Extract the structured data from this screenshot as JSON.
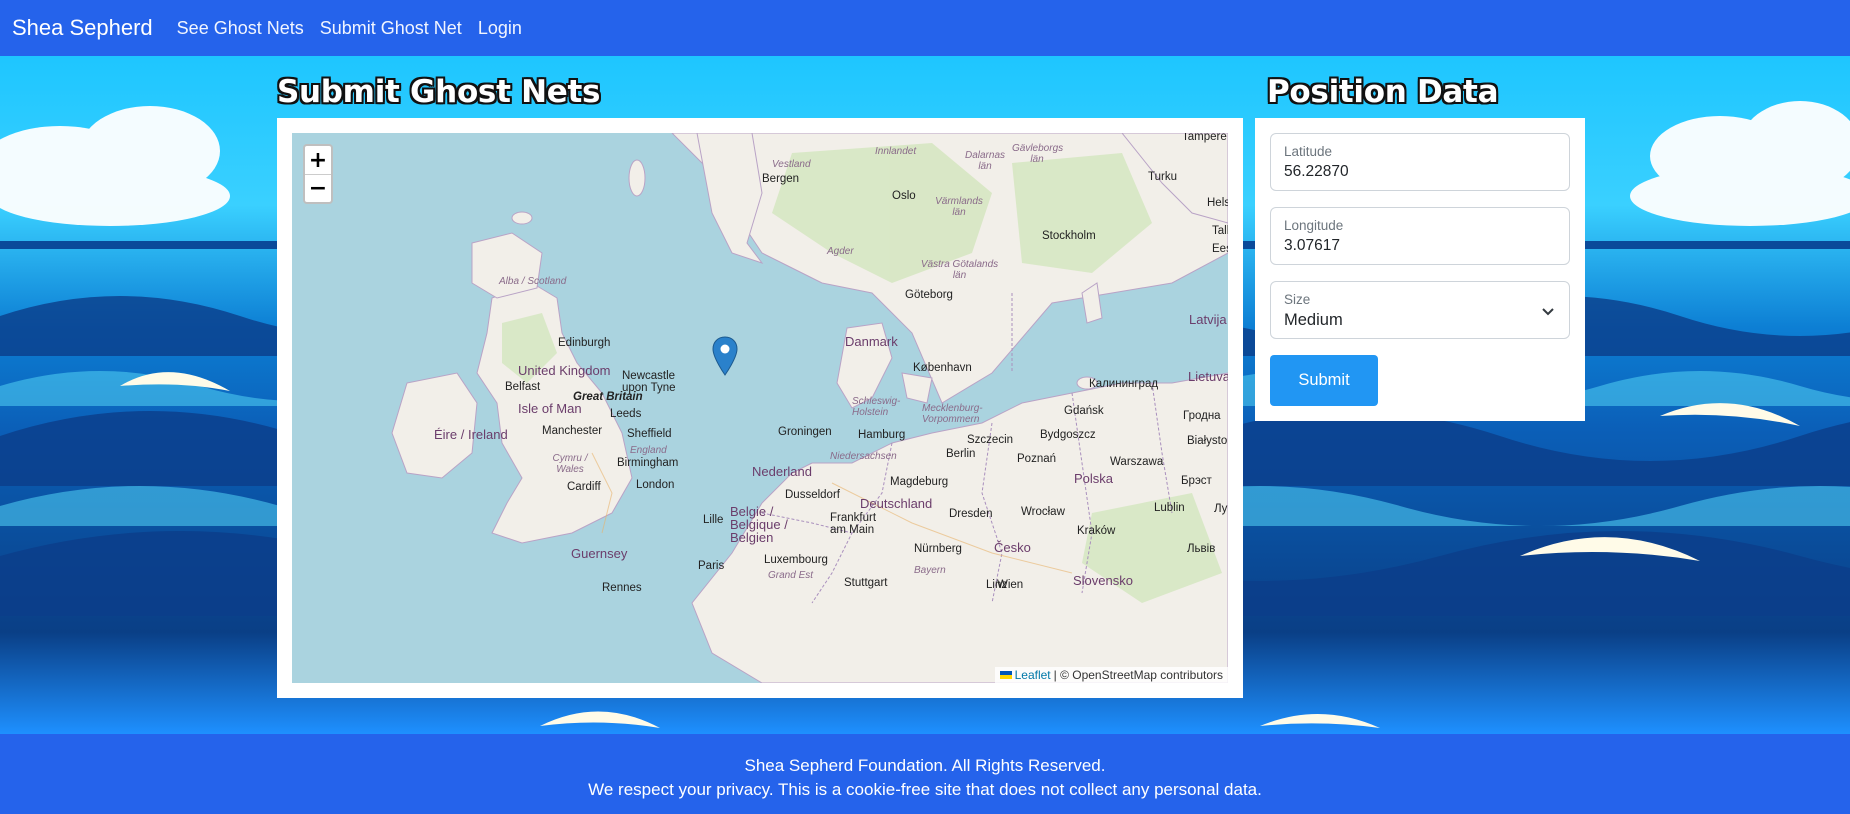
{
  "navbar": {
    "brand": "Shea Sepherd",
    "links": [
      "See Ghost Nets",
      "Submit Ghost Net",
      "Login"
    ]
  },
  "main": {
    "title": "Submit Ghost Nets",
    "map": {
      "zoom_in": "+",
      "zoom_out": "−",
      "attribution_leaflet": "Leaflet",
      "attribution_rest": "| © OpenStreetMap contributors",
      "places": [
        "Tampere",
        "Bergen",
        "Oslo",
        "Turku",
        "Stockholm",
        "Helsi",
        "Tallin",
        "Eest",
        "Agder",
        "Vestland",
        "Innlandet",
        "Dalarnas län",
        "Gävleborgs län",
        "Värmlands län",
        "Västra Götalands län",
        "Göteborg",
        "Danmark",
        "København",
        "Latvija",
        "Lietuva",
        "Калининград",
        "Gdańsk",
        "Alba / Scotland",
        "Edinburgh",
        "United Kingdom",
        "Newcastle upon Tyne",
        "Great Britain",
        "Belfast",
        "Isle of Man",
        "Éire / Ireland",
        "Manchester",
        "Leeds",
        "Sheffield",
        "England",
        "Birmingham",
        "Cymru / Wales",
        "Cardiff",
        "London",
        "Guernsey",
        "Rennes",
        "Paris",
        "Lille",
        "Belgie / Belgique / Belgien",
        "Luxembourg",
        "Grand Est",
        "Stuttgart",
        "Frankfurt am Main",
        "Nürnberg",
        "Bayern",
        "Linz",
        "Wien",
        "Dusseldorf",
        "Nederland",
        "Groningen",
        "Niedersachsen",
        "Deutschland",
        "Hamburg",
        "Schleswig-Holstein",
        "Mecklenburg-Vorpommern",
        "Berlin",
        "Szczecin",
        "Bydgoszcz",
        "Poznań",
        "Warszawa",
        "Polska",
        "Magdeburg",
        "Dresden",
        "Wrocław",
        "Kraków",
        "Lublin",
        "Česko",
        "Slovensko",
        "Гродна",
        "Białystok",
        "Брэст",
        "Львів",
        "Лу"
      ]
    }
  },
  "position": {
    "title": "Position Data",
    "latitude_label": "Latitude",
    "latitude_value": "56.22870",
    "longitude_label": "Longitude",
    "longitude_value": "3.07617",
    "size_label": "Size",
    "size_value": "Medium",
    "submit_label": "Submit"
  },
  "footer": {
    "line1": "Shea Sepherd Foundation. All Rights Reserved.",
    "line2": "We respect your privacy. This is a cookie-free site that does not collect any personal data."
  },
  "colors": {
    "navbar": "#2563eb",
    "submit": "#2196f3",
    "sea": "#aad3df",
    "land": "#f2efe9"
  }
}
